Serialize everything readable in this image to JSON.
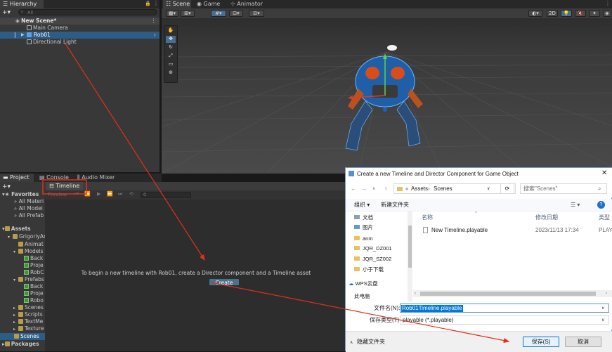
{
  "hierarchy": {
    "tab": "Hierarchy",
    "search_placeholder": "All",
    "scene": "New Scene*",
    "items": [
      "Main Camera",
      "Rob01",
      "Directional Light"
    ]
  },
  "scene_tabs": [
    "Scene",
    "Game",
    "Animator"
  ],
  "scene_toolbar": {
    "mode": "2D"
  },
  "project": {
    "tabs": [
      "Project",
      "Console",
      "Audio Mixer"
    ],
    "favorites_label": "Favorites",
    "favorites": [
      "All Materi",
      "All Model",
      "All Prefab"
    ],
    "assets_label": "Assets",
    "tree": [
      {
        "label": "GrigoriyAr",
        "indent": 1
      },
      {
        "label": "Animat",
        "indent": 2
      },
      {
        "label": "Models",
        "indent": 2
      },
      {
        "label": "Back",
        "indent": 3
      },
      {
        "label": "Proje",
        "indent": 3
      },
      {
        "label": "RobC",
        "indent": 3
      },
      {
        "label": "Prefabs",
        "indent": 2
      },
      {
        "label": "Back",
        "indent": 3
      },
      {
        "label": "Proje",
        "indent": 3
      },
      {
        "label": "Robo",
        "indent": 3
      },
      {
        "label": "Scenes",
        "indent": 2
      },
      {
        "label": "Scripts",
        "indent": 2
      },
      {
        "label": "TextMe",
        "indent": 2
      },
      {
        "label": "Texture",
        "indent": 2
      },
      {
        "label": "Scenes",
        "indent": 1
      }
    ],
    "packages_label": "Packages"
  },
  "timeline": {
    "tab": "Timeline",
    "preview": "Preview",
    "frame": "0",
    "message": "To begin a new timeline with Rob01, create a Director component and a Timeline asset",
    "create_button": "Create"
  },
  "dialog": {
    "title": "Create a new Timeline and Director Component for Game Object",
    "path": [
      "Assets",
      "Scenes"
    ],
    "search_placeholder": "搜索\"Scenes\"",
    "organize": "组织",
    "new_folder": "新建文件夹",
    "nav_items": [
      "文档",
      "图片",
      "anm",
      "JQR_DZ001",
      "JQR_SZ002",
      "小于下载",
      "WPS云盘",
      "此电脑"
    ],
    "columns": {
      "name": "名称",
      "modified": "修改日期",
      "type": "类型"
    },
    "files": [
      {
        "name": "New Timeline.playable",
        "modified": "2023/11/13 17:34",
        "type": "PLAY"
      }
    ],
    "filename_label": "文件名(N):",
    "filename_value": "Rob01Timeline.playable",
    "filetype_label": "保存类型(T):",
    "filetype_value": "playable (*.playable)",
    "hide_folders": "隐藏文件夹",
    "save_button": "保存(S)",
    "cancel_button": "取消"
  },
  "colors": {
    "selection": "#2c5d87",
    "annotation": "#e0301e",
    "accent": "#0078d7"
  }
}
